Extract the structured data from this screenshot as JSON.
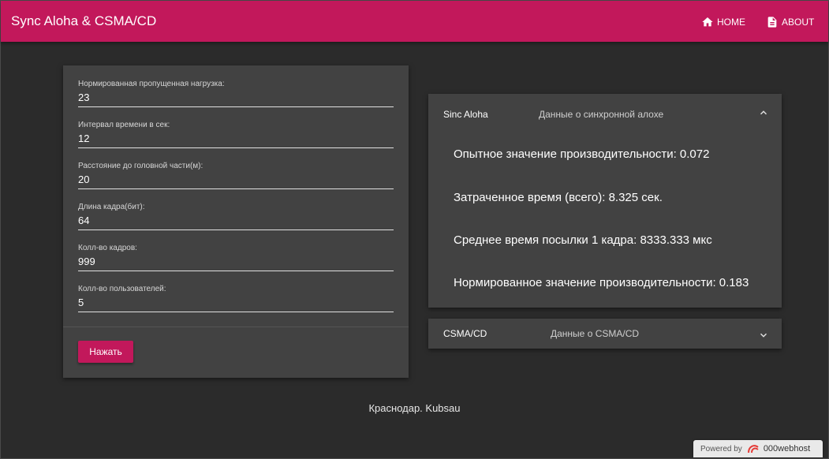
{
  "app": {
    "title": "Sync Aloha & CSMA/CD"
  },
  "nav": {
    "home_label": "HOME",
    "about_label": "ABOUT"
  },
  "form": {
    "fields": [
      {
        "label": "Нормированная пропущенная нагрузка:",
        "value": "23"
      },
      {
        "label": "Интервал времени в сек:",
        "value": "12"
      },
      {
        "label": "Расстояние до головной части(м):",
        "value": "20"
      },
      {
        "label": "Длина кадра(бит):",
        "value": "64"
      },
      {
        "label": "Колл-во кадров:",
        "value": "999"
      },
      {
        "label": "Колл-во пользователей:",
        "value": "5"
      }
    ],
    "submit_label": "Нажать"
  },
  "panels": {
    "aloha": {
      "title": "Sinc Aloha",
      "subtitle": "Данные о синхронной алохе",
      "expanded": true,
      "results": [
        "Опытное значение производительности: 0.072",
        "Затраченное время (всего): 8.325 сек.",
        "Среднее время посылки 1 кадра: 8333.333 мкс",
        "Нормированное значение производительности: 0.183"
      ]
    },
    "csma": {
      "title": "CSMA/CD",
      "subtitle": "Данные о CSMA/CD",
      "expanded": false
    }
  },
  "footer": {
    "text": "Краснодар. Kubsau"
  },
  "powered": {
    "prefix": "Powered by",
    "brand": "000webhost"
  },
  "colors": {
    "accent": "#c2185b",
    "background": "#2b2b2b",
    "card": "#424242"
  }
}
